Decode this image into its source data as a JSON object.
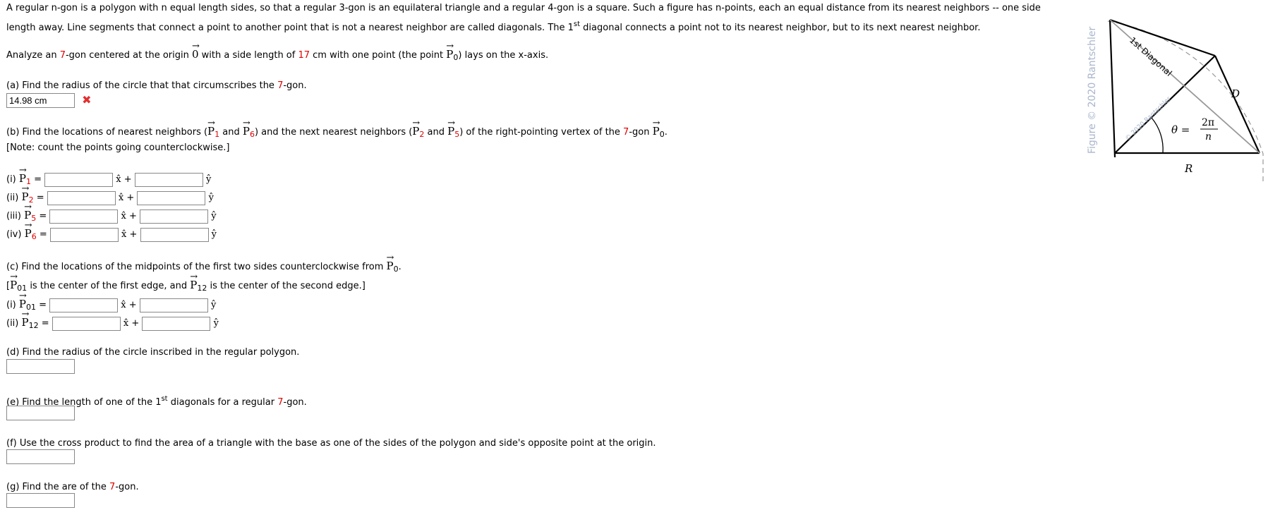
{
  "intro": {
    "line1": "A regular n-gon is a polygon with n equal length sides, so that a regular 3-gon is an equilateral triangle and a regular 4-gon is a square. Such a figure has n-points, each an equal distance from its nearest neighbors -- one side",
    "line2_a": "length away. Line segments that connect a point to another point that is not a nearest neighbor are called diagonals. The 1",
    "line2_sup": "st",
    "line2_b": " diagonal connects a point not to its nearest neighbor, but to its next nearest neighbor.",
    "analyze_a": "Analyze an ",
    "n": "7",
    "analyze_b": "-gon centered at the origin ",
    "origin": "0",
    "analyze_c": " with a side length of ",
    "side": "17",
    "analyze_d": " cm with one point (the point ",
    "p": "P",
    "p0sub": "0",
    "analyze_e": ") lays on the x-axis."
  },
  "parts": {
    "a": {
      "prompt_a": "(a) Find the radius of the circle that that circumscribes the ",
      "prompt_b": "-gon.",
      "answer": "14.98 cm",
      "status": "incorrect"
    },
    "b": {
      "prompt_a": "(b) Find the locations of nearest neighbors (",
      "s1": "1",
      "and": " and ",
      "s6": "6",
      "prompt_b": ") and the next nearest neighbors (",
      "s2": "2",
      "s5": "5",
      "prompt_c": ") of the right-pointing vertex of the ",
      "prompt_d": "-gon ",
      "s0": "0",
      "note": "[Note: count the points going counterclockwise.]",
      "rows": [
        {
          "label": "(i) ",
          "sub": "1"
        },
        {
          "label": "(ii) ",
          "sub": "2"
        },
        {
          "label": "(iii) ",
          "sub": "5"
        },
        {
          "label": "(iv) ",
          "sub": "6"
        }
      ]
    },
    "c": {
      "prompt": "(c) Find the locations of the midpoints of the first two sides counterclockwise from ",
      "note_a": "is the center of the first edge, and ",
      "note_b": " is the center of the second edge.]",
      "rows": [
        {
          "label": "(i) ",
          "sub": "01"
        },
        {
          "label": "(ii) ",
          "sub": "12"
        }
      ]
    },
    "d": {
      "prompt": "(d) Find the radius of the circle inscribed in the regular polygon."
    },
    "e": {
      "prompt_a": "(e) Find the length of one of the 1",
      "sup": "st",
      "prompt_b": " diagonals for a regular ",
      "prompt_c": "-gon."
    },
    "f": {
      "prompt": "(f) Use the cross product to find the area of a triangle with the base as one of the sides of the polygon and side's opposite point at the origin."
    },
    "g": {
      "prompt_a": "(g) Find the are of the ",
      "prompt_b": "-gon."
    }
  },
  "units": {
    "xhat": "x̂",
    "plus": " +",
    "yhat": "ŷ",
    "eq": " ="
  },
  "figure": {
    "credit": "Figure © 2020 Rantschler",
    "watermark": "© 2020 Rantschler",
    "diagonal_label": "1st Diagonal",
    "d_label": "D",
    "r_label": "R",
    "theta": "θ =",
    "num": "2π",
    "den": "n"
  },
  "colors": {
    "accent": "#e00000",
    "credit": "#a9b6cc"
  }
}
